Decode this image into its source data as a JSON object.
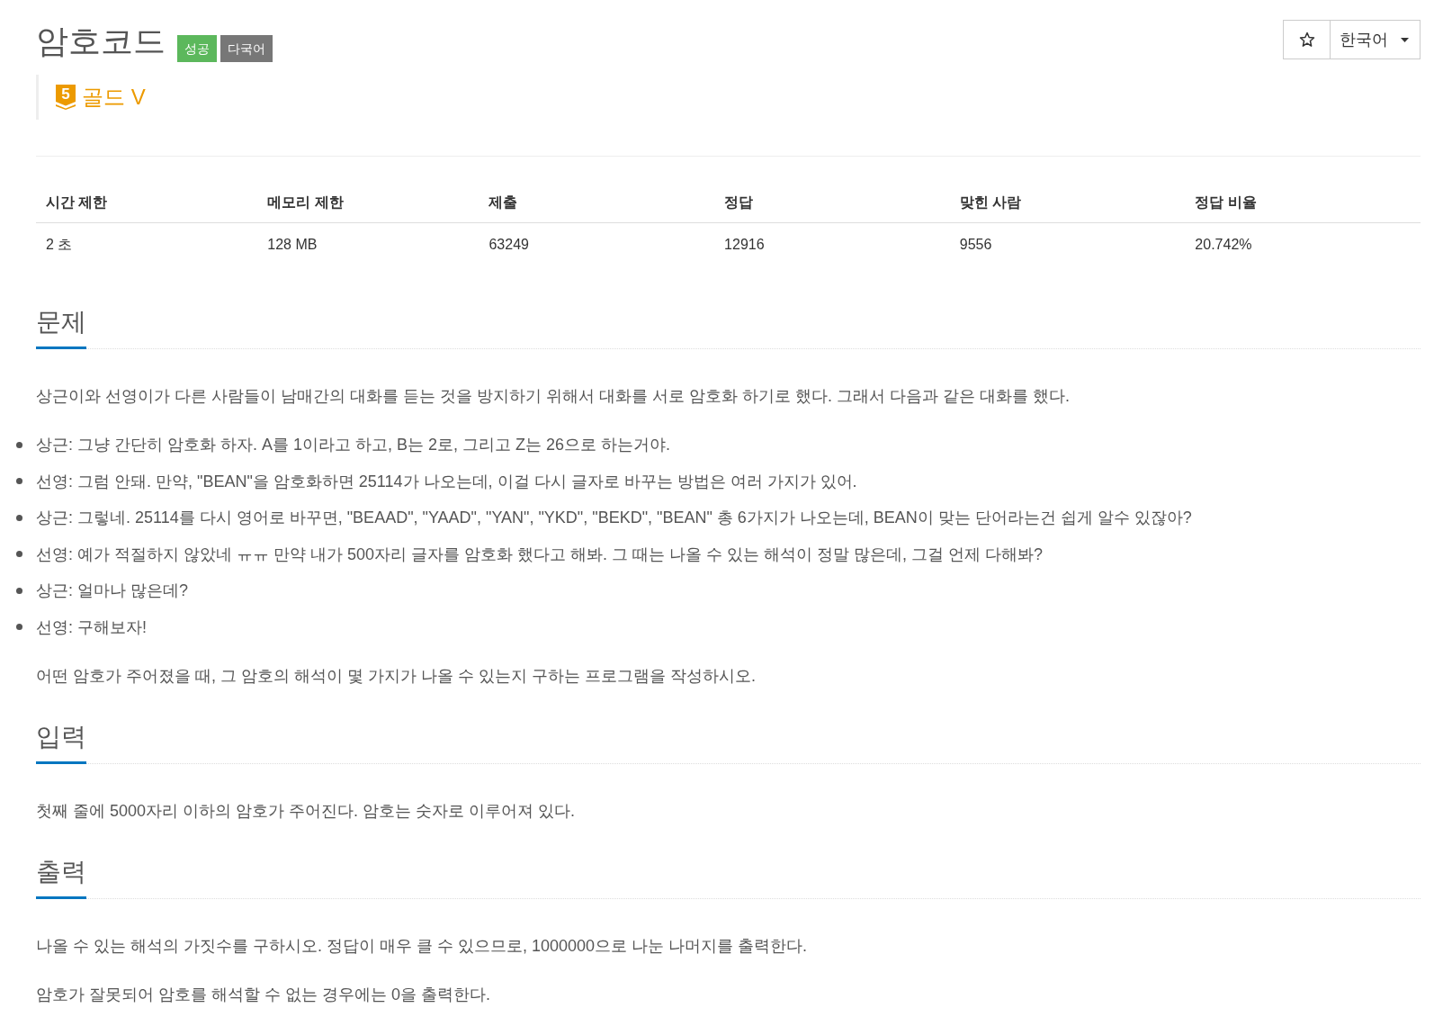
{
  "header": {
    "title": "암호코드",
    "badges": [
      {
        "label": "성공",
        "color": "#5cb85c"
      },
      {
        "label": "다국어",
        "color": "#777777"
      }
    ],
    "starred": false,
    "language": "한국어"
  },
  "tier": {
    "number": "5",
    "label": "골드 V"
  },
  "stats_table": {
    "columns": [
      "시간 제한",
      "메모리 제한",
      "제출",
      "정답",
      "맞힌 사람",
      "정답 비율"
    ],
    "rows": [
      [
        "2 초",
        "128 MB",
        "63249",
        "12916",
        "9556",
        "20.742%"
      ]
    ]
  },
  "sections": [
    {
      "heading": "문제",
      "blocks": [
        {
          "kind": "paragraph",
          "text": "상근이와 선영이가 다른 사람들이 남매간의 대화를 듣는 것을 방지하기 위해서 대화를 서로 암호화 하기로 했다. 그래서 다음과 같은 대화를 했다."
        },
        {
          "kind": "list",
          "items": [
            "상근: 그냥 간단히 암호화 하자. A를 1이라고 하고, B는 2로, 그리고 Z는 26으로 하는거야.",
            "선영: 그럼 안돼. 만약, \"BEAN\"을 암호화하면 25114가 나오는데, 이걸 다시 글자로 바꾸는 방법은 여러 가지가 있어.",
            "상근: 그렇네. 25114를 다시 영어로 바꾸면, \"BEAAD\", \"YAAD\", \"YAN\", \"YKD\", \"BEKD\", \"BEAN\" 총 6가지가 나오는데, BEAN이 맞는 단어라는건 쉽게 알수 있잖아?",
            "선영: 예가 적절하지 않았네 ㅠㅠ 만약 내가 500자리 글자를 암호화 했다고 해봐. 그 때는 나올 수 있는 해석이 정말 많은데, 그걸 언제 다해봐?",
            "상근: 얼마나 많은데?",
            "선영: 구해보자!"
          ]
        },
        {
          "kind": "paragraph",
          "text": "어떤 암호가 주어졌을 때, 그 암호의 해석이 몇 가지가 나올 수 있는지 구하는 프로그램을 작성하시오."
        }
      ]
    },
    {
      "heading": "입력",
      "blocks": [
        {
          "kind": "paragraph",
          "text": "첫째 줄에 5000자리 이하의 암호가 주어진다. 암호는 숫자로 이루어져 있다."
        }
      ]
    },
    {
      "heading": "출력",
      "blocks": [
        {
          "kind": "paragraph",
          "text": "나올 수 있는 해석의 가짓수를 구하시오. 정답이 매우 클 수 있으므로, 1000000으로 나눈 나머지를 출력한다."
        },
        {
          "kind": "paragraph",
          "text": "암호가 잘못되어 암호를 해석할 수 없는 경우에는 0을 출력한다."
        }
      ]
    }
  ]
}
